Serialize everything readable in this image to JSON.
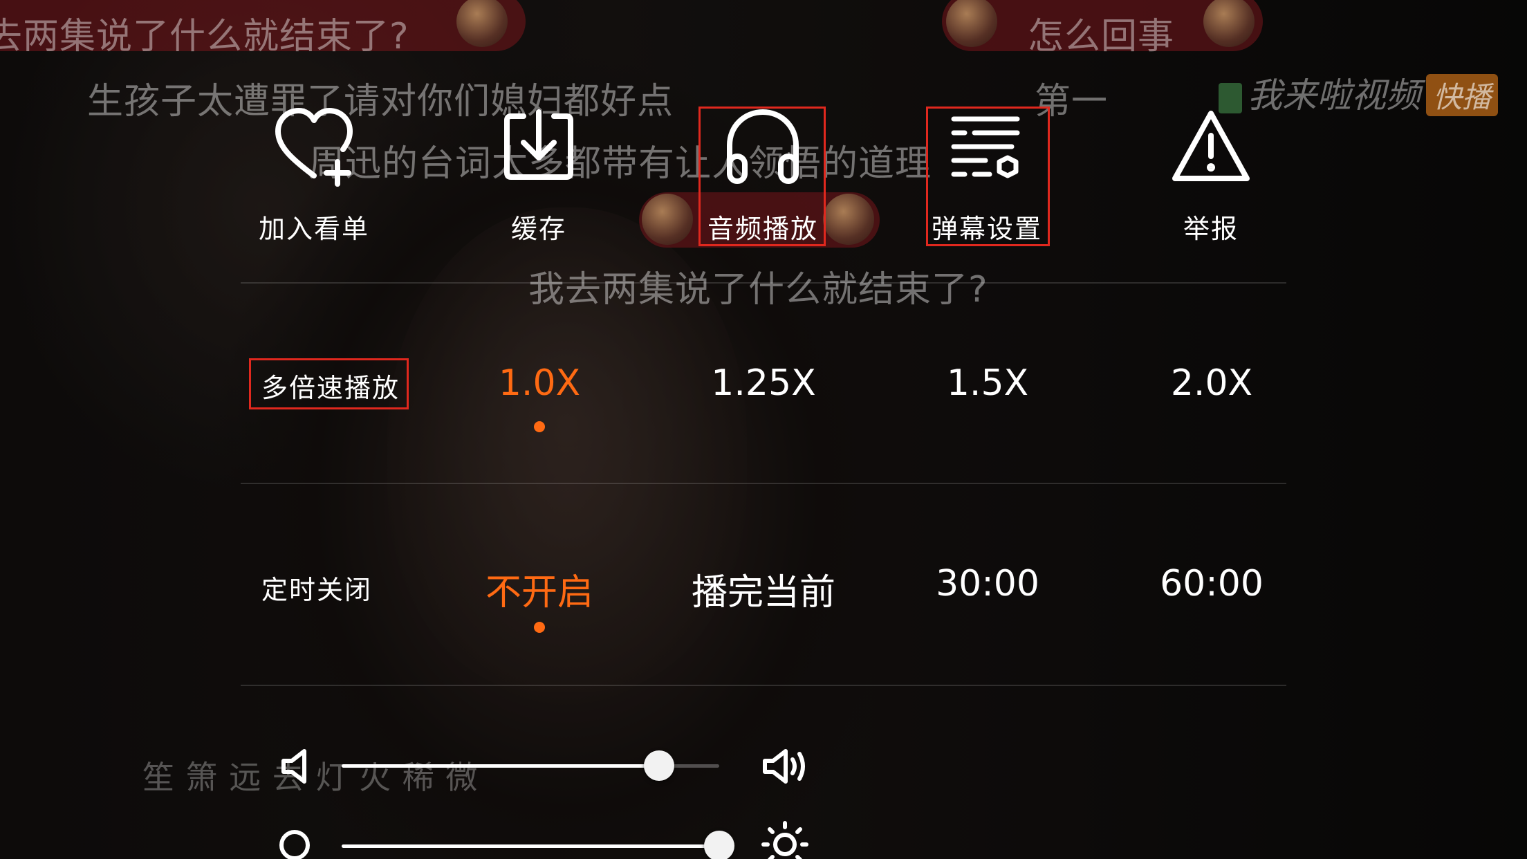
{
  "danmaku": [
    "去两集说了什么就结束了?",
    "怎么回事",
    "生孩子太遭罪了请对你们媳妇都好点",
    "第一",
    "周迅的台词太多都带有让人领悟的道理",
    "我去两集说了什么就结束了?",
    "笙 箫 远 去 灯 火 稀 微"
  ],
  "watermark": {
    "text": "我来啦视频",
    "tag": "快播"
  },
  "actions": [
    {
      "label": "加入看单",
      "icon": "heart-plus-icon"
    },
    {
      "label": "缓存",
      "icon": "download-icon"
    },
    {
      "label": "音频播放",
      "icon": "headphones-icon"
    },
    {
      "label": "弹幕设置",
      "icon": "danmaku-settings-icon"
    },
    {
      "label": "举报",
      "icon": "warning-icon"
    }
  ],
  "speed": {
    "label": "多倍速播放",
    "options": [
      "1.0X",
      "1.25X",
      "1.5X",
      "2.0X"
    ],
    "selected": "1.0X"
  },
  "timer": {
    "label": "定时关闭",
    "options": [
      "不开启",
      "播完当前",
      "30:00",
      "60:00"
    ],
    "selected": "不开启"
  },
  "volume": {
    "level": 0.84,
    "icons": [
      "volume-low-icon",
      "volume-high-icon"
    ]
  },
  "brightness": {
    "level": 1.0,
    "icons": [
      "brightness-low-icon",
      "brightness-high-icon"
    ]
  },
  "colors": {
    "accent": "#ff6a13",
    "highlight": "#e0281e",
    "text": "#ffffff"
  }
}
